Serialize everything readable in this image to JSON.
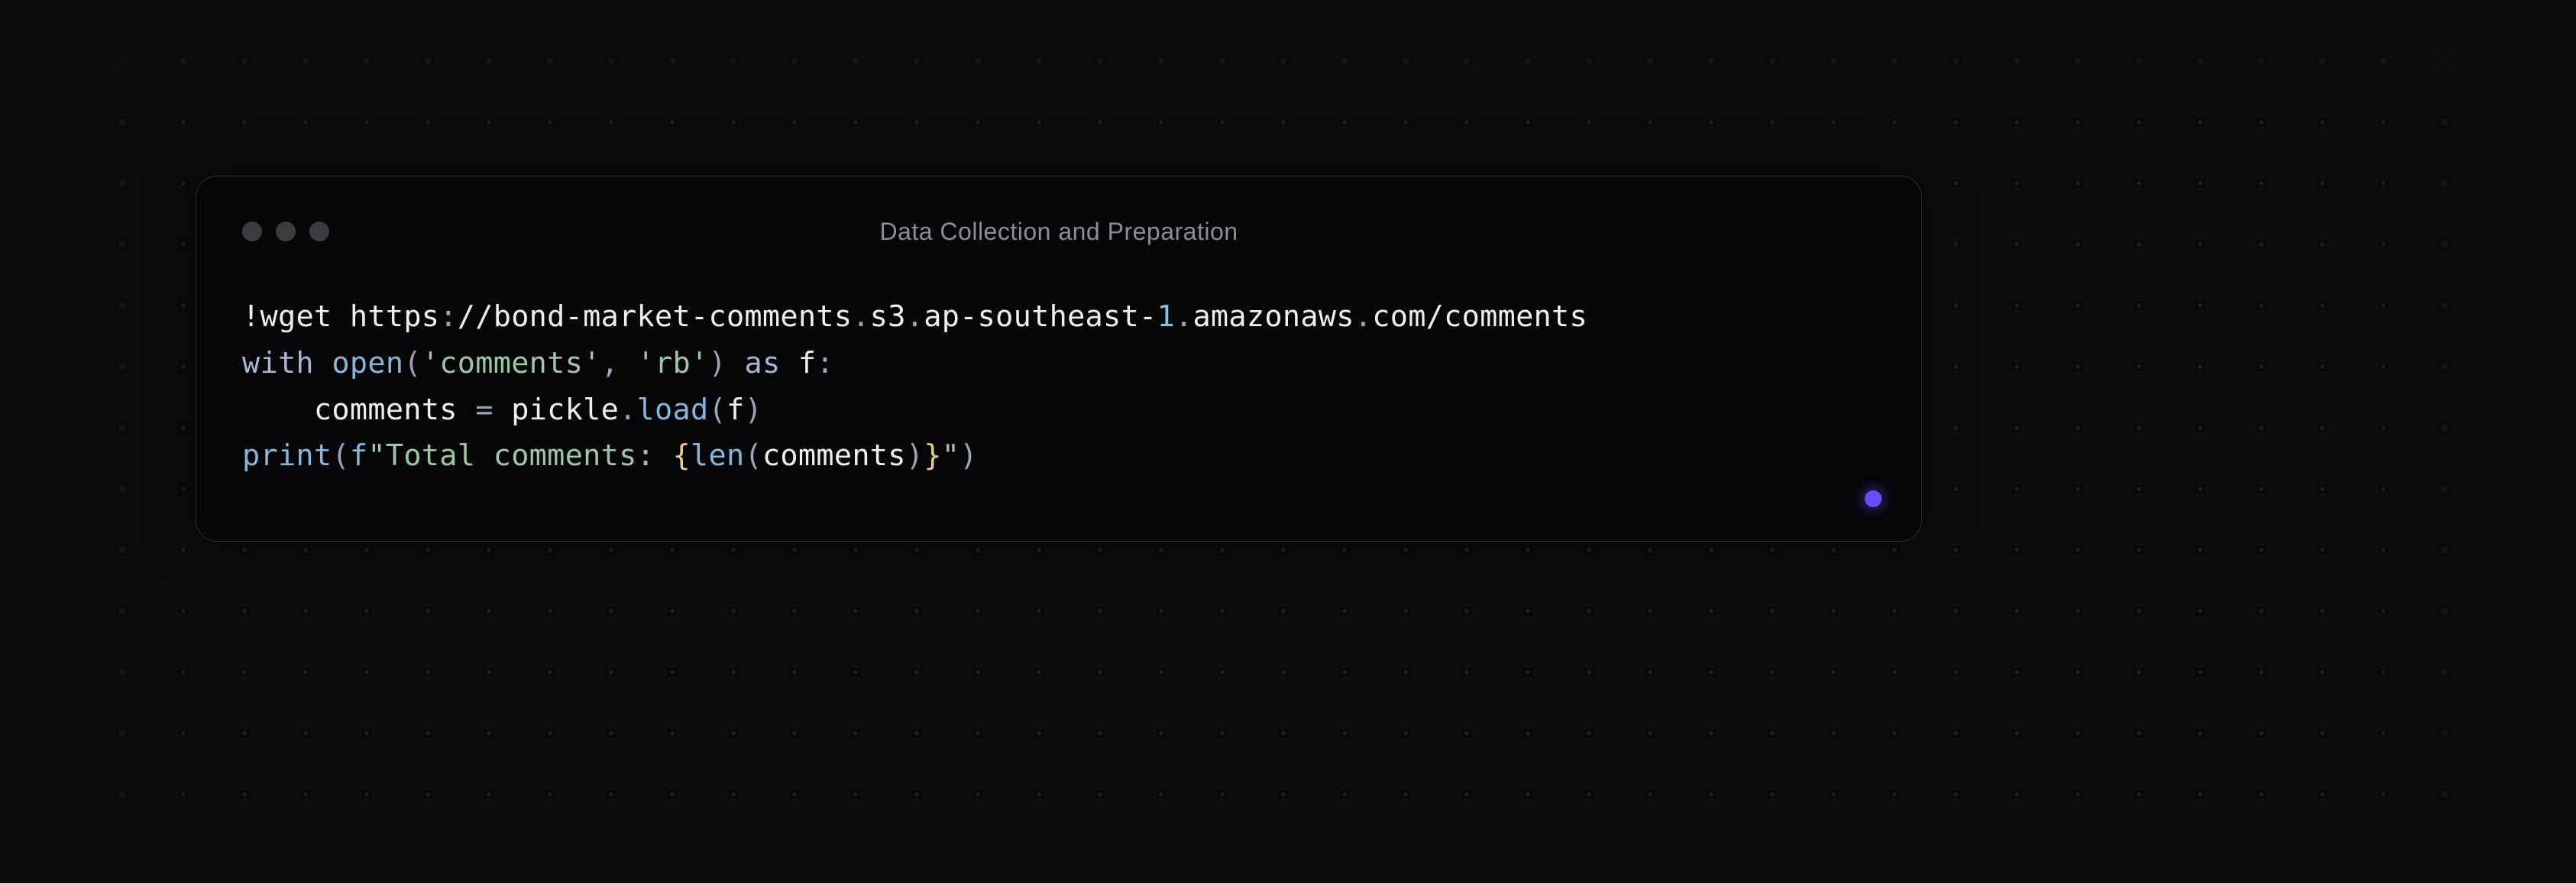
{
  "window": {
    "title": "Data Collection and Preparation"
  },
  "code": {
    "l1": {
      "bang": "!",
      "wget": "wget https",
      "colon": ":",
      "sl2": "//bond-market-comments",
      "dot1": ".",
      "s3": "s3",
      "dot2": ".",
      "ap": "ap-southeast-",
      "one": "1",
      "dot3": ".",
      "aws": "amazonaws",
      "dot4": ".",
      "com": "com/comments"
    },
    "l2": {
      "with": "with",
      "sp1": " ",
      "open": "open",
      "lp": "(",
      "arg1": "'comments'",
      "comma": ", ",
      "arg2": "'rb'",
      "rp": ")",
      "sp2": " ",
      "as": "as",
      "sp3": " f",
      "colon": ":"
    },
    "l3": {
      "indent": "    comments ",
      "eq": "=",
      "pickle": " pickle",
      "dot": ".",
      "load": "load",
      "lp": "(",
      "f": "f",
      "rp": ")"
    },
    "l4": {
      "print": "print",
      "lp": "(",
      "fpre": "f",
      "str1": "\"Total comments: ",
      "lb": "{",
      "len": "len",
      "lp2": "(",
      "var": "comments",
      "rp2": ")",
      "rb": "}",
      "str2": "\"",
      "rp": ")"
    }
  },
  "status": {
    "color": "#6a4cff"
  }
}
